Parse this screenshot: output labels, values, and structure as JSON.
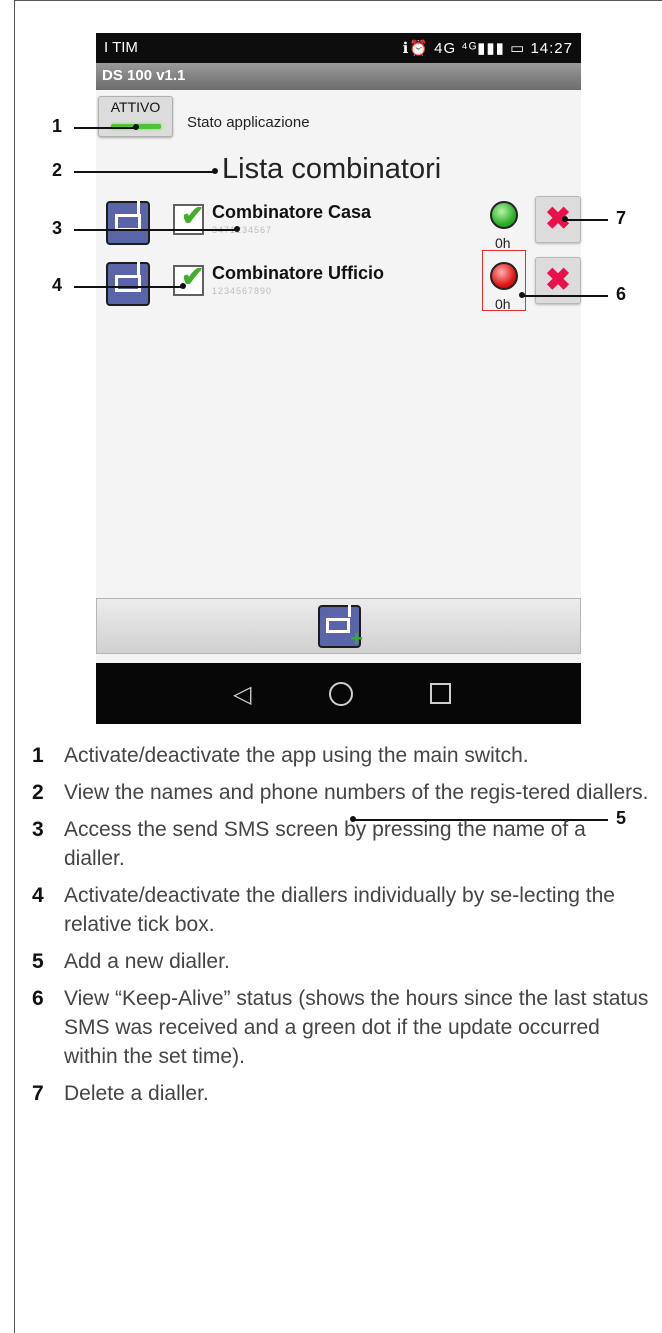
{
  "phone": {
    "carrier": "I TIM",
    "status_icons": "ℹ⏰ 4G ⁴ᴳ▮▮▮ ▭",
    "clock": "14:27",
    "app_title": "DS 100 v1.1",
    "switch_label": "ATTIVO",
    "app_state_label": "Stato applicazione",
    "list_title": "Lista combinatori",
    "diallers": [
      {
        "name": "Combinatore Casa",
        "number": "3471234567",
        "hours": "0h",
        "status_color": "#2fb02a"
      },
      {
        "name": "Combinatore Ufficio",
        "number": "1234567890",
        "hours": "0h",
        "status_color": "#e01818"
      }
    ],
    "icons": {
      "dialler": "dialler-icon",
      "check": "✔",
      "delete": "✖",
      "add": "+",
      "back": "◁"
    }
  },
  "callouts": [
    "1",
    "2",
    "3",
    "4",
    "5",
    "6",
    "7"
  ],
  "legend": [
    {
      "num": "1",
      "text": "Activate/deactivate the app using the main switch."
    },
    {
      "num": "2",
      "text": "View the names and phone numbers of the regis-tered diallers."
    },
    {
      "num": "3",
      "text": "Access the send SMS screen by pressing the name of a dialler."
    },
    {
      "num": "4",
      "text": "Activate/deactivate the diallers individually by se-lecting the relative tick box."
    },
    {
      "num": "5",
      "text": "Add a new dialler."
    },
    {
      "num": "6",
      "text": "View “Keep-Alive” status (shows the hours since the last status SMS was received and a green dot if the update occurred within the set time)."
    },
    {
      "num": "7",
      "text": "Delete a dialler."
    }
  ]
}
